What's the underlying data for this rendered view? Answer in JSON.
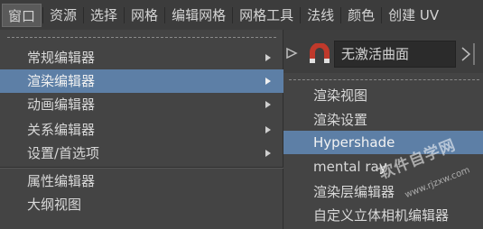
{
  "menubar": {
    "items": [
      {
        "label": "窗口",
        "active": true
      },
      {
        "label": "资源"
      },
      {
        "label": "选择"
      },
      {
        "label": "网格"
      },
      {
        "label": "编辑网格"
      },
      {
        "label": "网格工具"
      },
      {
        "label": "法线"
      },
      {
        "label": "颜色"
      },
      {
        "label": "创建 UV"
      }
    ]
  },
  "dropdown": {
    "items": [
      {
        "label": "常规编辑器",
        "submenu": true
      },
      {
        "label": "渲染编辑器",
        "submenu": true,
        "highlighted": true
      },
      {
        "label": "动画编辑器",
        "submenu": true
      },
      {
        "label": "关系编辑器",
        "submenu": true
      },
      {
        "label": "设置/首选项",
        "submenu": true
      },
      {
        "label": "属性编辑器"
      },
      {
        "label": "大纲视图"
      }
    ]
  },
  "toolbar": {
    "field_value": "无激活曲面",
    "icons": [
      "snap-icon",
      "magnet-icon",
      "arrow-right-icon"
    ]
  },
  "submenu": {
    "items": [
      {
        "label": "渲染视图"
      },
      {
        "label": "渲染设置"
      },
      {
        "label": "Hypershade",
        "highlighted": true
      },
      {
        "label": "mental ray"
      },
      {
        "label": "渲染层编辑器"
      },
      {
        "label": "自定义立体相机编辑器"
      }
    ]
  },
  "watermark": {
    "text": "软件自学网",
    "url": "www.rjzxw.com"
  },
  "colors": {
    "menu_bg": "#444444",
    "highlight": "#5d7fa6",
    "menubar_bg": "#3c3c3c"
  }
}
